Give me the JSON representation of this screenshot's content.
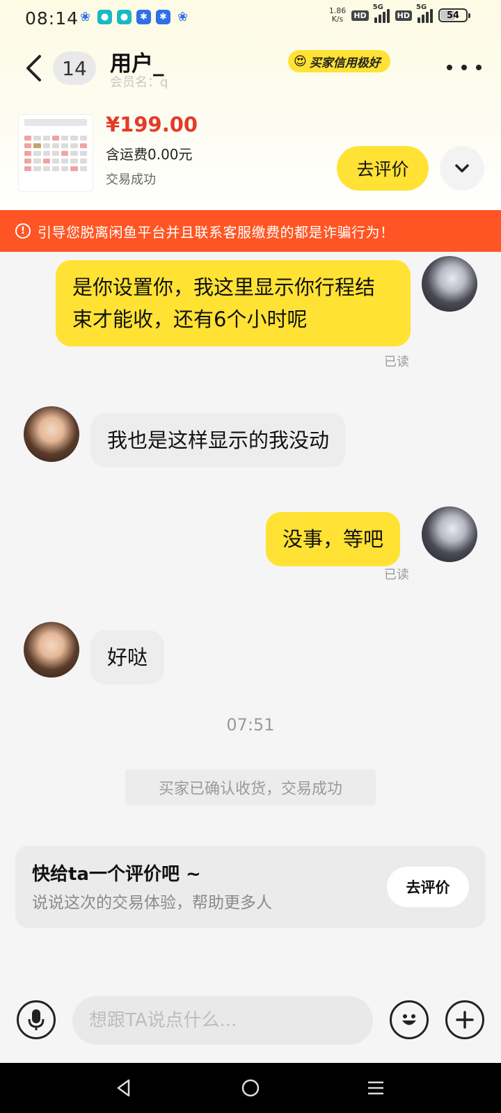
{
  "status_bar": {
    "time": "08:14",
    "net_speed_value": "1.86",
    "net_speed_unit": "K/s",
    "hd_label": "HD",
    "network_label": "5G",
    "battery": "54",
    "battery_level": 0.54
  },
  "header": {
    "back_icon": "chevron-left-icon",
    "unread_count": "14",
    "user_name": "用户_",
    "member_label": "会员名：q",
    "credit_badge": "买家信用极好",
    "more_icon": "more-dots-icon"
  },
  "product": {
    "price": "¥199.00",
    "shipping": "含运费0.00元",
    "status": "交易成功",
    "review_button": "去评价",
    "expand_icon": "chevron-down-icon"
  },
  "warning": {
    "text": "引导您脱离闲鱼平台并且联系客服缴费的都是诈骗行为！",
    "color": "#ff5524"
  },
  "messages": [
    {
      "from": "self",
      "text": "是你设置你，我这里显示你行程结束才能收，还有6个小时呢",
      "read": "已读"
    },
    {
      "from": "other",
      "text": "我也是这样显示的我没动"
    },
    {
      "from": "self",
      "text": "没事，等吧",
      "read": "已读"
    },
    {
      "from": "other",
      "text": "好哒"
    }
  ],
  "timestamp": "07:51",
  "system_notice": "买家已确认收货，交易成功",
  "review_card": {
    "title": "快给ta一个评价吧 ~",
    "subtitle": "说说这次的交易体验，帮助更多人",
    "button": "去评价"
  },
  "input_bar": {
    "placeholder": "想跟TA说点什么...",
    "voice_icon": "microphone-icon",
    "emoji_icon": "emoji-icon",
    "plus_icon": "plus-icon"
  },
  "colors": {
    "accent_yellow": "#ffe234",
    "price_red": "#e23b28",
    "warning_orange": "#ff5524"
  }
}
